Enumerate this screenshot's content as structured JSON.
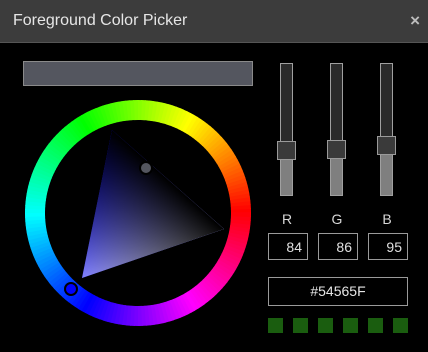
{
  "window": {
    "title": "Foreground Color Picker",
    "close_label": "×"
  },
  "color": {
    "hex": "#54565F",
    "preview_color": "#54565F",
    "r": 84,
    "g": 86,
    "b": 95,
    "hue_marker_color": "#0000ff"
  },
  "channels": [
    {
      "key": "r",
      "label": "R",
      "value": "84",
      "level": 0.33
    },
    {
      "key": "g",
      "label": "G",
      "value": "86",
      "level": 0.34
    },
    {
      "key": "b",
      "label": "B",
      "value": "95",
      "level": 0.37
    }
  ],
  "swatches": [
    "#1a5d0f",
    "#1a5d0f",
    "#1a5d0f",
    "#1a5d0f",
    "#1a5d0f",
    "#1a5d0f"
  ]
}
